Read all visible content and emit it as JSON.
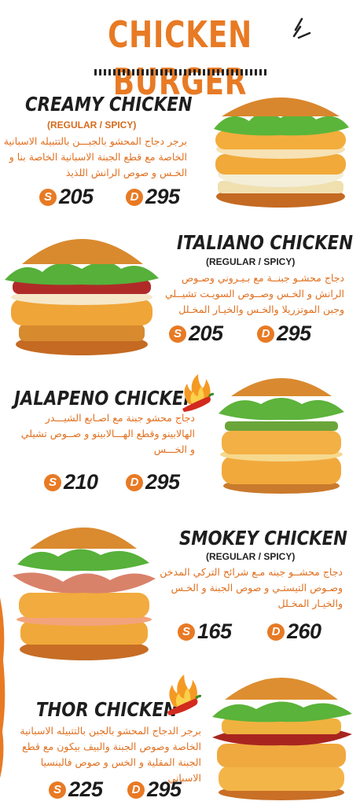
{
  "header": {
    "title": "CHICKEN BURGER"
  },
  "items": [
    {
      "name": "CREAMY CHICKEN",
      "variant": "(REGULAR / SPICY)",
      "description": "برجر دجاج المحشو بالجبـــن بالتتبيله الاسبانية الخاصة مع قطع الجبنة الاسبانية الخاصة بنا و الخـس و صوص الرانش اللذيذ",
      "price_single_badge": "S",
      "price_single": "205",
      "price_double_badge": "D",
      "price_double": "295"
    },
    {
      "name": "ITALIANO CHICKEN",
      "variant": "(REGULAR / SPICY)",
      "description": "دجاج محشـو جبنــة مع بـيـروني وصـوص الرانش و الخـس وصــوص السويـت تشيــلي وجبن الموتزريلا والخـس والخيـار المخـلل",
      "price_single_badge": "S",
      "price_single": "205",
      "price_double_badge": "D",
      "price_double": "295"
    },
    {
      "name": "JALAPENO CHICKEN",
      "description": "دجاج محشو جبنة مع اصـابع الشيـــدر الهالابينو وقطع الهـــالابينو و صــوص تشيلي و الخـــس",
      "price_single_badge": "S",
      "price_single": "210",
      "price_double_badge": "D",
      "price_double": "295"
    },
    {
      "name": "SMOKEY CHICKEN",
      "variant": "(REGULAR / SPICY)",
      "description": "دجاج محشــو جبنه مـع شرائح التركي المدخن وصـوص التيستـي و صوص الجبنة و الخـس والخيـار المخـلل",
      "price_single_badge": "S",
      "price_single": "165",
      "price_double_badge": "D",
      "price_double": "260"
    },
    {
      "name": "THOR CHICKEN",
      "description": "برجر الدجاج المحشو بالجبن بالتتبيله الاسبانية الخاصة وصوص الجبنة والبيف بيكون مع قطع الجبنة المقلية و الخس و صوص فالينسيا الاسباني",
      "price_single_badge": "S",
      "price_single": "225",
      "price_double_badge": "D",
      "price_double": "295"
    }
  ],
  "colors": {
    "accent": "#e87a24",
    "text_dark": "#1c1c1c"
  }
}
